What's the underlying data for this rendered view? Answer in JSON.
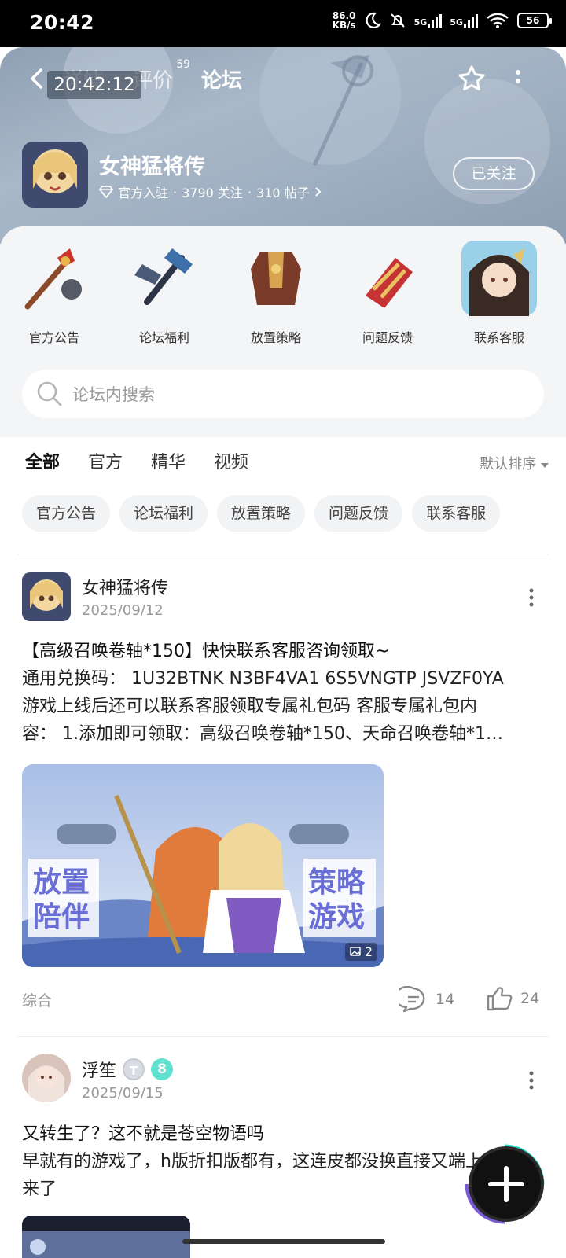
{
  "status_bar": {
    "time": "20:42",
    "net_speed_value": "86.0",
    "net_speed_unit": "KB/s",
    "signal1": "5G",
    "signal2": "5G",
    "battery": "56"
  },
  "nav": {
    "tabs": [
      {
        "label": "详情",
        "active": false
      },
      {
        "label": "评价",
        "count": "59",
        "active": false
      },
      {
        "label": "论坛",
        "active": true
      }
    ],
    "time_overlay": "20:42:12",
    "icons": [
      "back-icon",
      "star-icon",
      "more-vertical-icon"
    ]
  },
  "game": {
    "title": "女神猛将传",
    "meta_official": "官方入驻",
    "meta_follows": "3790 关注",
    "meta_posts": "310 帖子",
    "follow_label": "已关注"
  },
  "categories": [
    {
      "label": "官方公告",
      "icon": "mace-icon"
    },
    {
      "label": "论坛福利",
      "icon": "warhammer-icon"
    },
    {
      "label": "放置策略",
      "icon": "armor-icon"
    },
    {
      "label": "问题反馈",
      "icon": "gauntlet-icon"
    },
    {
      "label": "联系客服",
      "icon": "character-portrait-icon"
    }
  ],
  "search": {
    "placeholder": "论坛内搜索"
  },
  "filter_tabs": [
    {
      "label": "全部",
      "active": true
    },
    {
      "label": "官方",
      "active": false
    },
    {
      "label": "精华",
      "active": false
    },
    {
      "label": "视频",
      "active": false
    }
  ],
  "sort_label": "默认排序",
  "chips": [
    "官方公告",
    "论坛福利",
    "放置策略",
    "问题反馈",
    "联系客服"
  ],
  "posts": [
    {
      "author": "女神猛将传",
      "date": "2025/09/12",
      "title": "【高级召唤卷轴*150】快快联系客服咨询领取~",
      "body_line1": "通用兑换码：  1U32BTNK N3BF4VA1 6S5VNGTP JSVZF0YA",
      "body_line2": "游戏上线后还可以联系客服领取专属礼包码 客服专属礼包内",
      "body_line3": "容：  1.添加即可领取：高级召唤卷轴*150、天命召唤卷轴*1…",
      "image_text_left1": "放置",
      "image_text_left2": "陪伴",
      "image_text_right1": "策略",
      "image_text_right2": "游戏",
      "image_count": "2",
      "tag": "综合",
      "comments": "14",
      "likes": "24"
    },
    {
      "author": "浮笙",
      "badge_t": "T",
      "badge_level": "8",
      "date": "2025/09/15",
      "title": "又转生了？这不就是苍空物语吗",
      "body_line1": "早就有的游戏了，h版折扣版都有，这连皮都没换直接又端上",
      "body_line2": "来了"
    }
  ],
  "fab_icon": "plus-icon"
}
